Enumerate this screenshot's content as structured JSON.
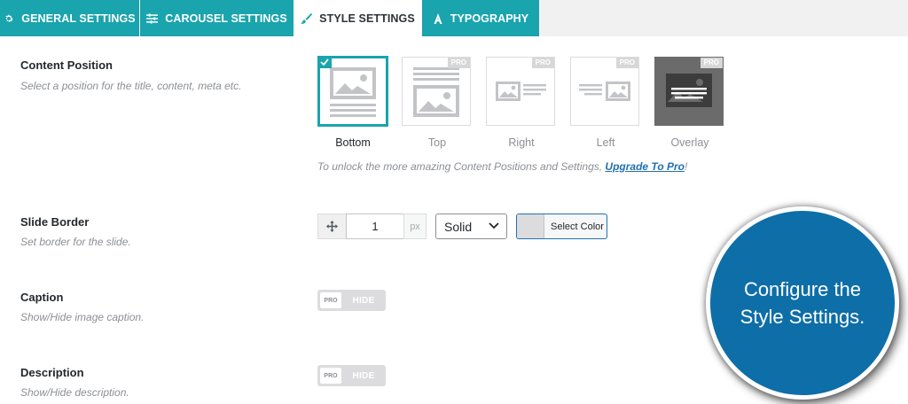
{
  "tabs": [
    {
      "label": "GENERAL SETTINGS",
      "icon": "gear-icon"
    },
    {
      "label": "CAROUSEL SETTINGS",
      "icon": "sliders-icon"
    },
    {
      "label": "STYLE SETTINGS",
      "icon": "paintbrush-icon"
    },
    {
      "label": "TYPOGRAPHY",
      "icon": "typography-icon"
    }
  ],
  "active_tab": "STYLE SETTINGS",
  "content_position": {
    "label": "Content Position",
    "description": "Select a position for the title, content, meta etc.",
    "options": [
      {
        "label": "Bottom",
        "selected": true
      },
      {
        "label": "Top",
        "pro": "PRO"
      },
      {
        "label": "Right",
        "pro": "PRO"
      },
      {
        "label": "Left",
        "pro": "PRO"
      },
      {
        "label": "Overlay",
        "pro": "PRO"
      }
    ],
    "note_prefix": "To unlock the more amazing Content Positions and Settings, ",
    "note_link": "Upgrade To Pro",
    "note_suffix": "!"
  },
  "slide_border": {
    "label": "Slide Border",
    "description": "Set border for the slide.",
    "width_value": "1",
    "unit": "px",
    "style_value": "Solid",
    "color_button": "Select Color"
  },
  "caption": {
    "label": "Caption",
    "description": "Show/Hide image caption.",
    "toggle_badge": "PRO",
    "toggle_state": "HIDE"
  },
  "description_row": {
    "label": "Description",
    "description": "Show/Hide description.",
    "toggle_badge": "PRO",
    "toggle_state": "HIDE"
  },
  "callout": {
    "line1": "Configure the",
    "line2": "Style Settings."
  },
  "colors": {
    "accent": "#1aa4ad",
    "link": "#2271b1",
    "callout": "#0e6ea8"
  }
}
